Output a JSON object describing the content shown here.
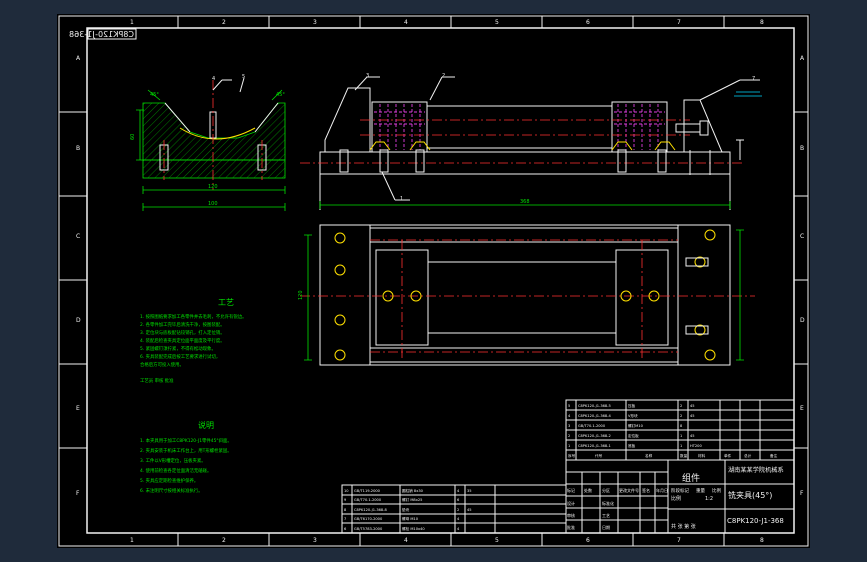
{
  "drawing": {
    "mirrored_code": "C8PK120-J1-368",
    "zone_letters": [
      "A",
      "B",
      "C",
      "D",
      "E",
      "F"
    ],
    "zone_numbers_top": [
      "1",
      "2",
      "3",
      "4",
      "5",
      "6",
      "7",
      "8"
    ],
    "zone_numbers_bottom": [
      "1",
      "2",
      "3",
      "4",
      "5",
      "6",
      "7",
      "8"
    ]
  },
  "notes_process": {
    "title": "工艺",
    "lines": [
      "1. 按照图纸要求加工各零件并去毛刺，不允许有锐边。",
      "2. 各零件加工完毕后清洗干净，按图装配。",
      "3. 定位块与底板配钻铰销孔，打入定位销。",
      "4. 装配后检查夹具定位面平面度及平行度。",
      "5. 紧固螺钉须拧紧，不得有松动现象。",
      "6. 夹具装配完成后按工艺要求进行试切，",
      "   合格后方可投入使用。",
      "   工艺员  审核  批准"
    ]
  },
  "notes_tech": {
    "title": "说明",
    "lines": [
      "1. 本夹具用于加工C8PK120-J1零件45°斜面。",
      "2. 夹具安装于机床工作台上，用T形螺栓紧固。",
      "3. 工件以V形槽定位，压板夹紧。",
      "4. 使用前检查各定位面清洁无磕碰。",
      "5. 夹具应定期检查维护保养。",
      "6. 未注明尺寸按相关标准执行。"
    ]
  },
  "bom_upper": [
    [
      "5",
      "C8PK120-J1-368-5",
      "压板",
      "2",
      "45",
      "",
      ""
    ],
    [
      "4",
      "C8PK120-J1-368-4",
      "V形块",
      "2",
      "45",
      "",
      ""
    ],
    [
      "3",
      "GB/T70.1-2000",
      "螺钉M10",
      "8",
      "",
      "",
      ""
    ],
    [
      "2",
      "C8PK120-J1-368-2",
      "定位板",
      "1",
      "45",
      "",
      ""
    ],
    [
      "1",
      "C8PK120-J1-368-1",
      "底板",
      "1",
      "HT200",
      "",
      ""
    ]
  ],
  "bom_upper_header": [
    "序号",
    "代号",
    "名称",
    "数量",
    "材料",
    "单件",
    "总计",
    "备注"
  ],
  "bom_lower": [
    [
      "10",
      "GB/T119-2000",
      "圆柱销 8x30",
      "4",
      "35",
      "",
      ""
    ],
    [
      "9",
      "GB/T70.1-2000",
      "螺钉 M8x25",
      "6",
      "",
      "",
      ""
    ],
    [
      "8",
      "C8PK120-J1-368-8",
      "垫块",
      "2",
      "45",
      "",
      ""
    ],
    [
      "7",
      "GB/T6170-2000",
      "螺母 M10",
      "4",
      "",
      "",
      ""
    ],
    [
      "6",
      "GB/T5783-2000",
      "螺栓 M10x40",
      "4",
      "",
      "",
      ""
    ]
  ],
  "title_block": {
    "type_label": "组件",
    "company": "湖南某某学院机械系",
    "drawing_name": "铣夹具(45°)",
    "drawing_number": "C8PK120-J1-368",
    "scale_label": "比例",
    "scale_value": "1:2",
    "sheet_label": "共 张 第 张",
    "design_row": [
      "设计",
      "",
      "标准化",
      ""
    ],
    "check_row": [
      "审核",
      "",
      "工艺",
      ""
    ],
    "approve_row": [
      "批准",
      "",
      "日期",
      ""
    ],
    "header_row": [
      "标记",
      "处数",
      "分区",
      "更改文件号",
      "签名",
      "年月日"
    ],
    "stage_row": [
      "阶段标记",
      "重量",
      "比例"
    ]
  },
  "labels": {
    "left_view_callouts": [
      "4",
      "5"
    ],
    "front_view_callouts": [
      "3",
      "2",
      "1",
      "7"
    ],
    "dims": [
      "120",
      "100",
      "45°",
      "45°",
      "60",
      "368",
      "120"
    ]
  }
}
